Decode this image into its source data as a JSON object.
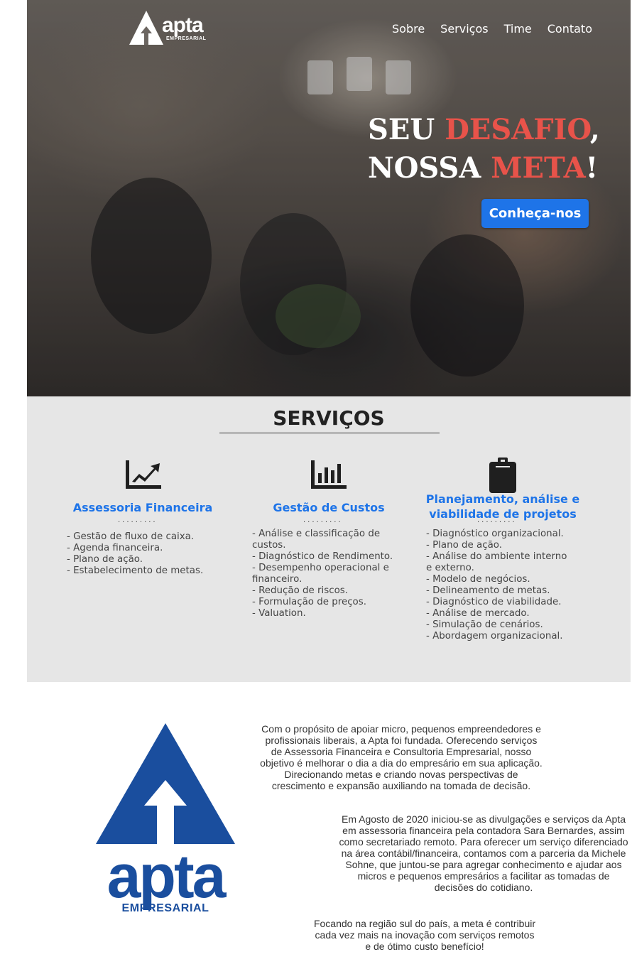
{
  "header": {
    "logo_text": "apta",
    "logo_subtext": "EMPRESARIAL",
    "nav": [
      "Sobre",
      "Serviços",
      "Time",
      "Contato"
    ]
  },
  "hero": {
    "line1_white": "SEU ",
    "line1_accent": "DESAFIO",
    "line1_end": ",",
    "line2_white": "NOSSA ",
    "line2_accent": "META",
    "line2_end": "!",
    "cta_label": "Conheça-nos",
    "accent_color": "#e8534a",
    "button_color": "#1e74e8"
  },
  "services": {
    "title": "SERVIÇOS",
    "dots": ".........",
    "items": [
      {
        "icon": "line-chart-icon",
        "title": "Assessoria Financeira",
        "lines": [
          "- Gestão de fluxo de caixa.",
          "- Agenda financeira.",
          "- Plano de ação.",
          "- Estabelecimento de metas."
        ]
      },
      {
        "icon": "bar-chart-icon",
        "title": "Gestão de Custos",
        "lines": [
          "- Análise e classificação de",
          "custos.",
          "- Diagnóstico de Rendimento.",
          "- Desempenho operacional e",
          "financeiro.",
          "- Redução de riscos.",
          "- Formulação de preços.",
          "- Valuation."
        ]
      },
      {
        "icon": "clipboard-icon",
        "title_line1": "Planejamento, análise e",
        "title_line2": "viabilidade de projetos",
        "lines": [
          "- Diagnóstico organizacional.",
          "- Plano de ação.",
          "- Análise do ambiente interno",
          "e externo.",
          "- Modelo de negócios.",
          "- Delineamento de metas.",
          "- Diagnóstico de viabilidade.",
          "- Análise de mercado.",
          "- Simulação de cenários.",
          "- Abordagem organizacional."
        ]
      }
    ]
  },
  "about": {
    "logo_text": "apta",
    "logo_subtext": "EMPRESARIAL",
    "brand_color": "#1a4e9e",
    "p1": [
      "Com o propósito de apoiar micro, pequenos empreendedores e",
      "profissionais liberais, a Apta foi fundada. Oferecendo serviços",
      "de Assessoria Financeira e Consultoria Empresarial, nosso",
      "objetivo é melhorar o dia a dia do empresário em sua aplicação.",
      "Direcionando metas e criando novas perspectivas de",
      "crescimento e expansão auxiliando na tomada de decisão."
    ],
    "p2": [
      "Em Agosto de 2020 iniciou-se as divulgações e serviços da Apta",
      "em assessoria financeira pela contadora Sara Bernardes, assim",
      "como secretariado remoto. Para oferecer um serviço diferenciado",
      "na área contábil/financeira, contamos com a parceria da Michele",
      "Sohne, que juntou-se para agregar conhecimento e ajudar aos",
      "micros e pequenos empresários a facilitar as tomadas de",
      "decisões do cotidiano."
    ],
    "p3": [
      "Focando na região sul do país, a meta é contribuir",
      "cada vez mais na inovação com serviços remotos",
      "e de ótimo custo benefício!"
    ]
  }
}
